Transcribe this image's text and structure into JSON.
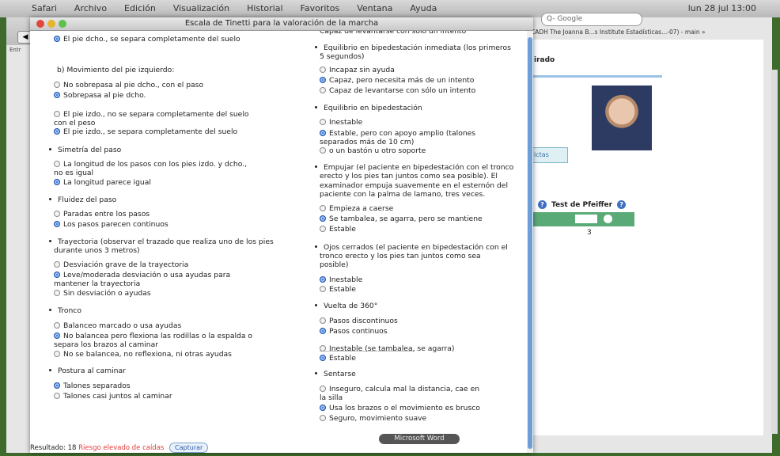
{
  "menubar": {
    "items": [
      "Safari",
      "Archivo",
      "Edición",
      "Visualización",
      "Historial",
      "Favoritos",
      "Ventana",
      "Ayuda"
    ],
    "clock": "lun 28 jul 13:00"
  },
  "browser": {
    "search_placeholder": "Q- Google",
    "tab_label": "Entr",
    "bookmarks": "MPCADH  The Joanna B...s Institute  Estadísticas...-07) - main  »",
    "page_heading": "irado",
    "link_chip": "ictas",
    "pfeiffer_label": "Test de Pfeiffer",
    "pfeiffer_value": "3"
  },
  "dialog": {
    "title": "Escala de Tinetti para la valoración de la marcha",
    "left": [
      {
        "kind": "opt",
        "on": true,
        "text": "El pie dcho., se separa completamente del suelo"
      },
      {
        "kind": "head",
        "text": "b) Movimiento del pie izquierdo:"
      },
      {
        "kind": "opt",
        "on": false,
        "text": "No sobrepasa al pie dcho., con el paso"
      },
      {
        "kind": "opt",
        "on": true,
        "text": "Sobrepasa al pie dcho."
      },
      {
        "kind": "opt",
        "on": false,
        "text": "El pie izdo., no se separa completamente del suelo"
      },
      {
        "kind": "cont",
        "text": "con el peso"
      },
      {
        "kind": "opt",
        "on": true,
        "text": "El pie izdo., se separa completamente del suelo"
      },
      {
        "kind": "bullet",
        "text": "Simetría del paso"
      },
      {
        "kind": "opt",
        "on": false,
        "text": "La longitud de los pasos con los pies izdo. y dcho.,"
      },
      {
        "kind": "cont",
        "text": "no es igual"
      },
      {
        "kind": "opt",
        "on": true,
        "text": "La longitud parece igual"
      },
      {
        "kind": "bullet",
        "text": "Fluidez del paso"
      },
      {
        "kind": "opt",
        "on": false,
        "text": "Paradas entre los pasos"
      },
      {
        "kind": "opt",
        "on": true,
        "text": "Los pasos parecen continuos"
      },
      {
        "kind": "bullet",
        "text": "Trayectoria (observar el trazado que realiza uno de los pies"
      },
      {
        "kind": "cont",
        "text": "durante unos 3 metros)"
      },
      {
        "kind": "opt",
        "on": false,
        "text": "Desviación grave de la trayectoria"
      },
      {
        "kind": "opt",
        "on": true,
        "text": "Leve/moderada desviación o usa ayudas para"
      },
      {
        "kind": "cont",
        "text": "mantener la trayectoria"
      },
      {
        "kind": "opt",
        "on": false,
        "text": "Sin desviación o ayudas"
      },
      {
        "kind": "bullet",
        "text": "Tronco"
      },
      {
        "kind": "opt",
        "on": false,
        "text": "Balanceo marcado o usa ayudas"
      },
      {
        "kind": "opt",
        "on": true,
        "text": "No balancea pero flexiona las rodillas o la espalda o"
      },
      {
        "kind": "cont",
        "text": "separa los brazos al caminar"
      },
      {
        "kind": "opt",
        "on": false,
        "text": "No se balancea, no reflexiona, ni otras ayudas"
      },
      {
        "kind": "bullet",
        "text": "Postura al caminar"
      },
      {
        "kind": "opt",
        "on": true,
        "text": "Talones separados"
      },
      {
        "kind": "opt",
        "on": false,
        "text": "Talones casi juntos al caminar"
      }
    ],
    "right": [
      {
        "kind": "cont",
        "text": "Capaz de levantarse con sólo un intento"
      },
      {
        "kind": "bullet",
        "text": "Equilibrio en bipedestación inmediata (los primeros"
      },
      {
        "kind": "cont",
        "text": "5 segundos)"
      },
      {
        "kind": "opt",
        "on": false,
        "text": "Incapaz sin ayuda"
      },
      {
        "kind": "opt",
        "on": true,
        "text": "Capaz, pero necesita más de un intento"
      },
      {
        "kind": "opt",
        "on": false,
        "text": "Capaz de levantarse con sólo un intento"
      },
      {
        "kind": "bullet",
        "text": "Equilibrio en bipedestación"
      },
      {
        "kind": "opt",
        "on": false,
        "text": "Inestable"
      },
      {
        "kind": "opt",
        "on": true,
        "text": "Estable, pero con apoyo amplio (talones"
      },
      {
        "kind": "cont",
        "text": "separados más de 10 cm)"
      },
      {
        "kind": "opt",
        "on": false,
        "text": "o un bastón u otro soporte"
      },
      {
        "kind": "bullet",
        "text": "Empujar (el paciente en bipedestación con el tronco"
      },
      {
        "kind": "cont",
        "text": "erecto y los pies tan juntos como sea posible). El"
      },
      {
        "kind": "cont",
        "text": "examinador empuja suavemente en el esternón del"
      },
      {
        "kind": "cont",
        "text": "paciente con la palma de lamano, tres veces."
      },
      {
        "kind": "opt",
        "on": false,
        "text": "Empieza a caerse"
      },
      {
        "kind": "opt",
        "on": true,
        "text": "Se tambalea, se agarra, pero se mantiene"
      },
      {
        "kind": "opt",
        "on": false,
        "text": "Estable"
      },
      {
        "kind": "bullet",
        "text": "Ojos cerrados (el paciente en bipedestación con el"
      },
      {
        "kind": "cont",
        "text": "tronco erecto y los pies tan juntos como sea"
      },
      {
        "kind": "cont",
        "text": "posible)"
      },
      {
        "kind": "opt",
        "on": true,
        "text": "Inestable"
      },
      {
        "kind": "opt",
        "on": false,
        "text": "Estable"
      },
      {
        "kind": "bullet",
        "text": "Vuelta de 360°"
      },
      {
        "kind": "opt",
        "on": false,
        "text": "Pasos discontinuos"
      },
      {
        "kind": "opt",
        "on": true,
        "text": "Pasos continuos"
      },
      {
        "kind": "opt",
        "on": false,
        "text": "Inestable (se tambalea, se agarra)"
      },
      {
        "kind": "opt",
        "on": true,
        "text": "Estable"
      },
      {
        "kind": "bullet",
        "text": "Sentarse"
      },
      {
        "kind": "opt",
        "on": false,
        "text": "Inseguro, calcula mal la distancia, cae en"
      },
      {
        "kind": "cont",
        "text": "la silla"
      },
      {
        "kind": "opt",
        "on": true,
        "text": "Usa los brazos o el movimiento es brusco"
      },
      {
        "kind": "opt",
        "on": false,
        "text": "Seguro, movimiento suave"
      }
    ],
    "result_label": "Resultado: 18",
    "risk_text": "Riesgo elevado de caídas",
    "capture_label": "Capturar"
  },
  "dock": {
    "word_label": "Microsoft Word"
  },
  "colors": {
    "accent": "#2f6fd6",
    "risk": "#e53b3b",
    "frame": "#3e6a2c",
    "pfeiffer_bar": "#5aaa78"
  }
}
